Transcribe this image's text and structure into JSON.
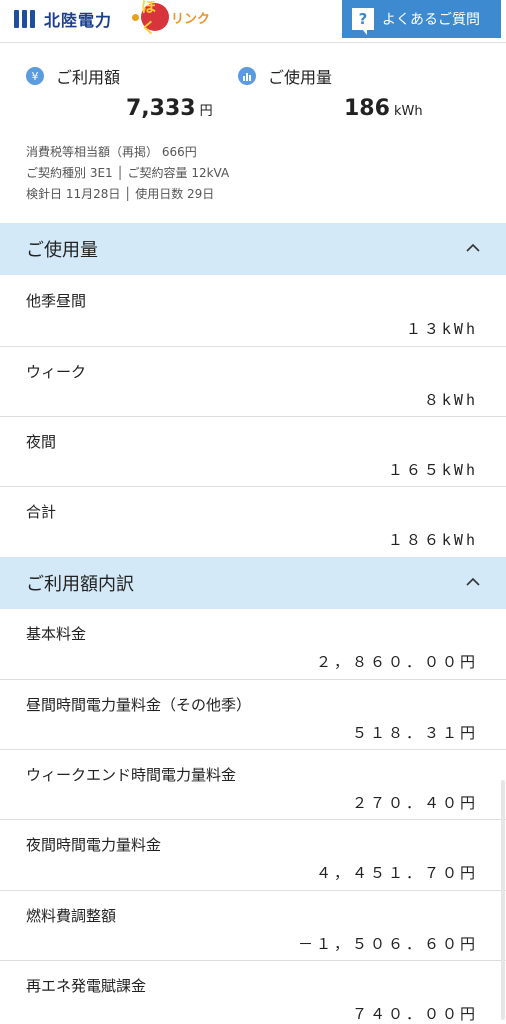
{
  "header": {
    "brand": "北陸電力",
    "hoku_char": "ほく",
    "hoku_text": "リンク",
    "faq_icon": "?",
    "faq_label": "よくあるご質問"
  },
  "summary": {
    "charge_label": "ご利用額",
    "charge_icon": "¥",
    "charge_value": "7,333",
    "charge_unit": "円",
    "usage_label": "ご使用量",
    "usage_icon": "bar-chart-icon",
    "usage_value": "186",
    "usage_unit": "kWh",
    "tax_line": "消費税等相当額（再掲） 666円",
    "contract_line": "ご契約種別 3E1 │ ご契約容量 12kVA",
    "meter_line": "検針日 11月28日 │ 使用日数 29日"
  },
  "usage_section": {
    "title": "ご使用量",
    "rows": [
      {
        "label": "他季昼間",
        "value": "１３kWh"
      },
      {
        "label": "ウィーク",
        "value": "８kWh"
      },
      {
        "label": "夜間",
        "value": "１６５kWh"
      },
      {
        "label": "合計",
        "value": "１８６kWh"
      }
    ]
  },
  "charge_section": {
    "title": "ご利用額内訳",
    "rows": [
      {
        "label": "基本料金",
        "value": "２，８６０．００円"
      },
      {
        "label": "昼間時間電力量料金（その他季）",
        "value": "５１８．３１円"
      },
      {
        "label": "ウィークエンド時間電力量料金",
        "value": "２７０．４０円"
      },
      {
        "label": "夜間時間電力量料金",
        "value": "４，４５１．７０円"
      },
      {
        "label": "燃料費調整額",
        "value": "－１，５０６．６０円"
      },
      {
        "label": "再エネ発電賦課金",
        "value": "７４０．００円"
      }
    ]
  }
}
